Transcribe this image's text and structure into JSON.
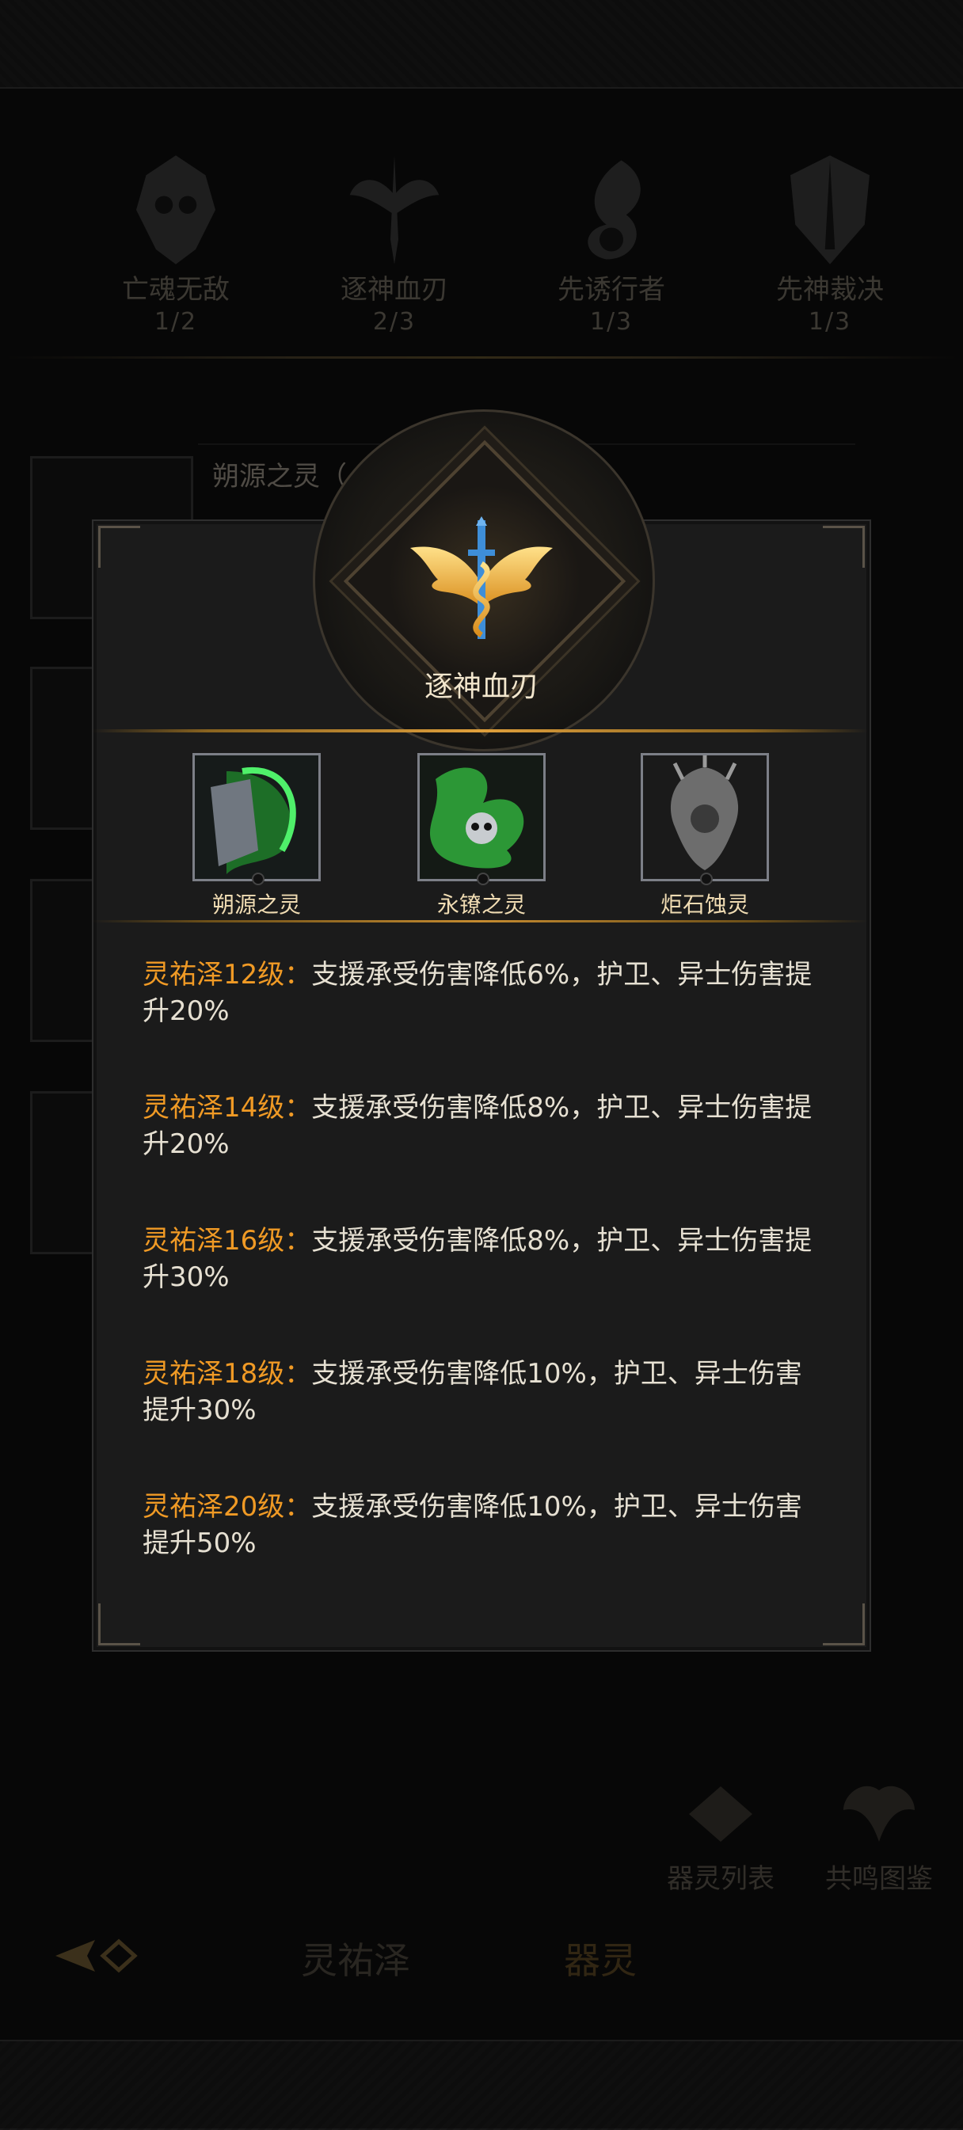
{
  "factions": [
    {
      "name": "亡魂无敌",
      "count": "1/2",
      "icon": "skull-crest-icon"
    },
    {
      "name": "逐神血刃",
      "count": "2/3",
      "icon": "winged-sword-icon"
    },
    {
      "name": "先诱行者",
      "count": "1/3",
      "icon": "swirl-feather-icon"
    },
    {
      "name": "先神裁决",
      "count": "1/3",
      "icon": "shield-spire-icon"
    }
  ],
  "background_list": {
    "first_item_label": "朔源之灵（"
  },
  "bottom_bar": {
    "list_button": "器灵列表",
    "codex_button": "共鸣图鉴",
    "tabs": [
      "灵祐泽",
      "器灵"
    ],
    "back_icon": "back-arrow-icon"
  },
  "popup": {
    "title": "逐神血刃",
    "emblem_icon": "winged-sword-icon",
    "members": [
      {
        "name": "朔源之灵",
        "color": "#3fcf4a"
      },
      {
        "name": "永镣之灵",
        "color": "#46d65a"
      },
      {
        "name": "炬石蚀灵",
        "color": "#9a9a9a"
      }
    ],
    "effects": [
      {
        "level": "灵祐泽12级：",
        "text": "支援承受伤害降低6%，护卫、异士伤害提升20%"
      },
      {
        "level": "灵祐泽14级：",
        "text": "支援承受伤害降低8%，护卫、异士伤害提升20%"
      },
      {
        "level": "灵祐泽16级：",
        "text": "支援承受伤害降低8%，护卫、异士伤害提升30%"
      },
      {
        "level": "灵祐泽18级：",
        "text": "支援承受伤害降低10%，护卫、异士伤害提升30%"
      },
      {
        "level": "灵祐泽20级：",
        "text": "支援承受伤害降低10%，护卫、异士伤害提升50%"
      }
    ]
  },
  "colors": {
    "accent": "#f09a25",
    "gold": "#e0a03c",
    "title": "#f2e6cd"
  }
}
